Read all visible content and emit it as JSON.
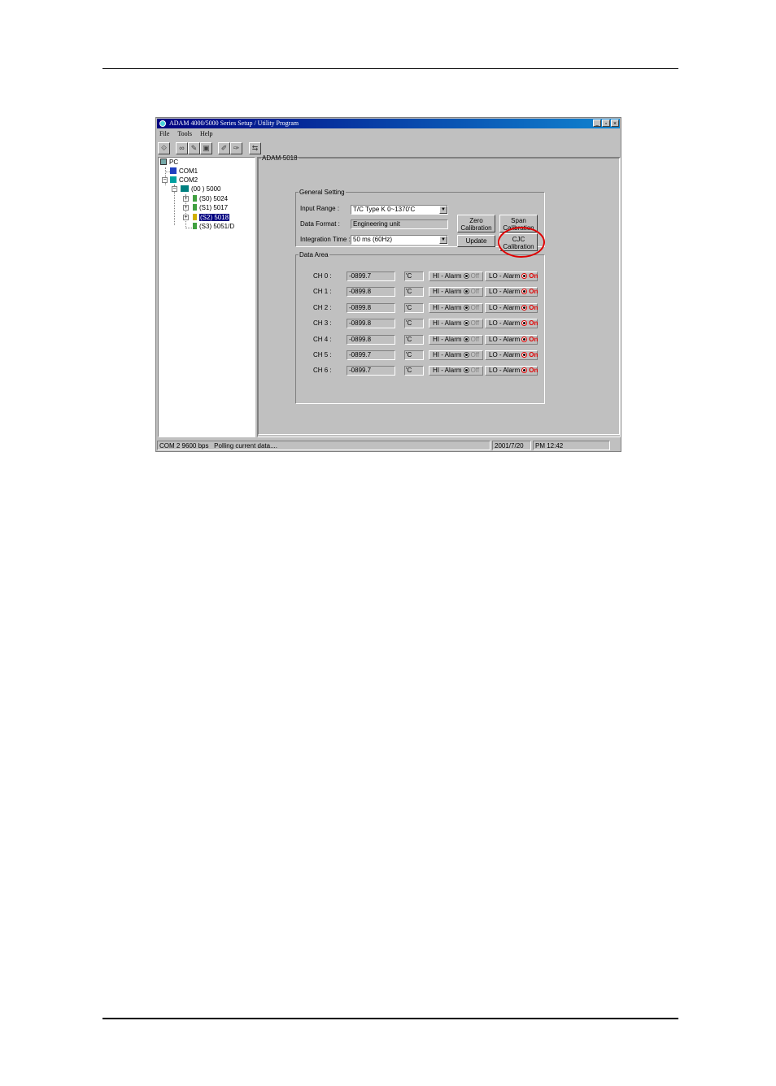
{
  "window": {
    "title": "ADAM 4000/5000 Series Setup / Utility Program",
    "buttons": [
      "_",
      "▫",
      "×"
    ]
  },
  "menu": [
    "File",
    "Tools",
    "Help"
  ],
  "tree": {
    "root": "PC",
    "com1": "COM1",
    "com2": "COM2",
    "base": "(00 ) 5000",
    "slots": [
      "(S0) 5024",
      "(S1) 5017",
      "(S2) 5018",
      "(S3) 5051/D"
    ]
  },
  "panel": {
    "module": "ADAM-5018",
    "general": {
      "legend": "General Setting",
      "input_range_label": "Input Range :",
      "input_range_value": "T/C Type K 0~1370'C",
      "data_format_label": "Data Format :",
      "data_format_value": "Engineering unit",
      "integration_label": "Integration Time :",
      "integration_value": "50 ms (60Hz)",
      "zero_cal": [
        "Zero",
        "Calibration"
      ],
      "span_cal": [
        "Span",
        "Calibration"
      ],
      "update": "Update",
      "cjc_cal": [
        "CJC",
        "Calibration"
      ]
    },
    "data": {
      "legend": "Data Area",
      "channels": [
        {
          "label": "CH  0  :",
          "value": "-0899.7",
          "unit": "'C"
        },
        {
          "label": "CH  1  :",
          "value": "-0899.8",
          "unit": "'C"
        },
        {
          "label": "CH  2  :",
          "value": "-0899.8",
          "unit": "'C"
        },
        {
          "label": "CH  3  :",
          "value": "-0899.8",
          "unit": "'C"
        },
        {
          "label": "CH  4  :",
          "value": "-0899.8",
          "unit": "'C"
        },
        {
          "label": "CH  5  :",
          "value": "-0899.7",
          "unit": "'C"
        },
        {
          "label": "CH  6  :",
          "value": "-0899.7",
          "unit": "'C"
        }
      ],
      "hi_label": "HI - Alarm",
      "lo_label": "LO - Alarm",
      "off_text": "Off",
      "on_text": "On"
    }
  },
  "status": {
    "port": "COM 2  9600  bps",
    "message": "Polling current data....",
    "date": "2001/7/20",
    "time": "PM 12:42"
  },
  "colors": {
    "alarm_on": "#e00000",
    "highlight_circle": "#e00000",
    "title_gradient_start": "#000080"
  }
}
